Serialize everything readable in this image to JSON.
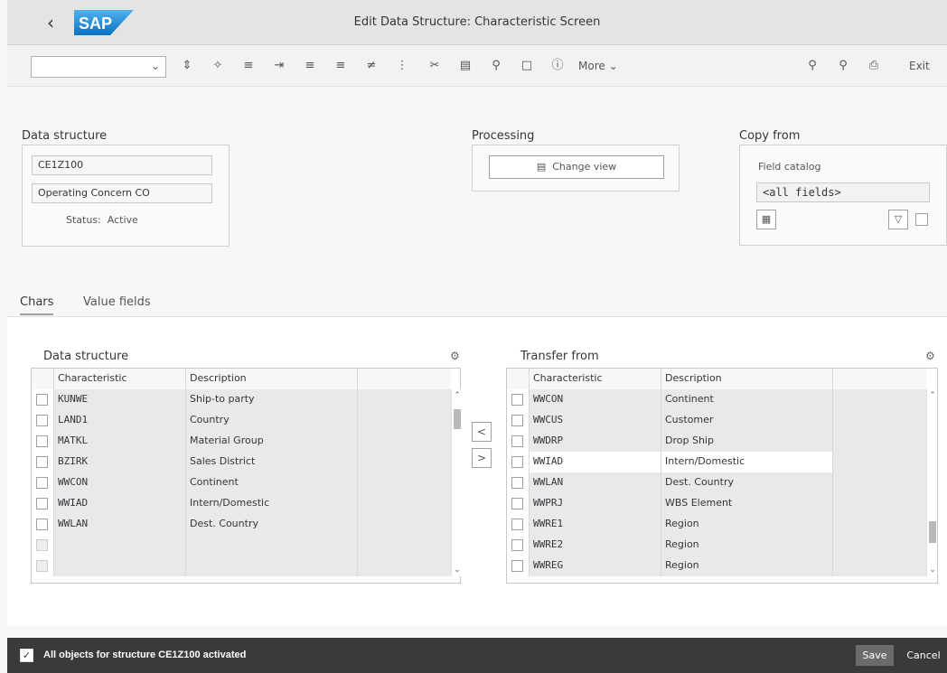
{
  "window": {
    "title": "Edit Data Structure: Characteristic Screen",
    "logo_text": "SAP"
  },
  "toolbar": {
    "command_field_value": "",
    "icons": [
      "vertical-align-icon",
      "magic-wand-icon",
      "tree-icon",
      "indent-icon",
      "align-center-icon",
      "align-left-icon",
      "numbered-list-icon",
      "bullet-list-icon",
      "cut-icon",
      "paste-icon",
      "zoom-icon",
      "document-icon",
      "info-icon"
    ],
    "more_label": "More",
    "exit_label": "Exit"
  },
  "data_structure": {
    "label": "Data structure",
    "name": "CE1Z100",
    "description": "Operating Concern CO",
    "status_label": "Status:",
    "status_value": "Active"
  },
  "processing": {
    "label": "Processing",
    "change_view_label": "Change view"
  },
  "copy_from": {
    "label": "Copy from",
    "field_catalog_label": "Field catalog",
    "field_catalog_value": "<all fields>"
  },
  "tabs": [
    {
      "label": "Chars",
      "active": true
    },
    {
      "label": "Value fields",
      "active": false
    }
  ],
  "left_table": {
    "title": "Data structure",
    "columns": [
      "Characteristic",
      "Description"
    ],
    "rows": [
      {
        "characteristic": "KUNWE",
        "description": "Ship-to party"
      },
      {
        "characteristic": "LAND1",
        "description": "Country"
      },
      {
        "characteristic": "MATKL",
        "description": "Material Group"
      },
      {
        "characteristic": "BZIRK",
        "description": "Sales District"
      },
      {
        "characteristic": "WWCON",
        "description": "Continent"
      },
      {
        "characteristic": "WWIAD",
        "description": "Intern/Domestic"
      },
      {
        "characteristic": "WWLAN",
        "description": "Dest. Country"
      },
      {
        "characteristic": "",
        "description": ""
      },
      {
        "characteristic": "",
        "description": ""
      }
    ]
  },
  "right_table": {
    "title": "Transfer from",
    "columns": [
      "Characteristic",
      "Description"
    ],
    "rows": [
      {
        "characteristic": "WWCON",
        "description": "Continent"
      },
      {
        "characteristic": "WWCUS",
        "description": "Customer"
      },
      {
        "characteristic": "WWDRP",
        "description": "Drop Ship"
      },
      {
        "characteristic": "WWIAD",
        "description": "Intern/Domestic"
      },
      {
        "characteristic": "WWLAN",
        "description": "Dest. Country"
      },
      {
        "characteristic": "WWPRJ",
        "description": "WBS Element"
      },
      {
        "characteristic": "WWRE1",
        "description": "Region"
      },
      {
        "characteristic": "WWRE2",
        "description": "Region"
      },
      {
        "characteristic": "WWREG",
        "description": "Region"
      }
    ]
  },
  "status_bar": {
    "message": "All objects for structure CE1Z100 activated",
    "save_label": "Save",
    "cancel_label": "Cancel"
  }
}
